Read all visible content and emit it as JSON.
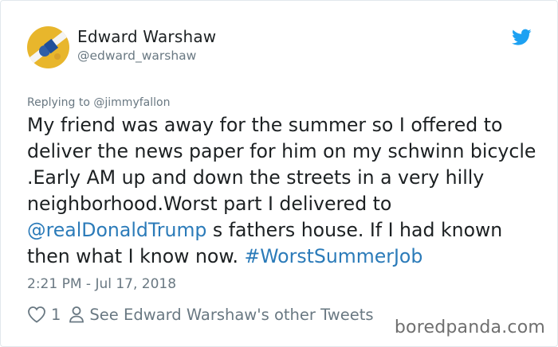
{
  "tweet": {
    "author_name": "Edward Warshaw",
    "author_handle": "@edward_warshaw",
    "replying_to_prefix": "Replying to ",
    "replying_to_handle": "@jimmyfallon",
    "text_1": "My friend was away for the summer so I offered to deliver the news paper for him on my schwinn bicycle .Early AM up and down the streets in a very hilly neighborhood.Worst part I delivered to ",
    "mention": "@realDonaldTrump",
    "text_2": " s fathers house. If I had known then what I know now. ",
    "hashtag": "#WorstSummerJob",
    "timestamp": "2:21 PM - Jul 17, 2018",
    "like_count": "1",
    "see_other_tweets": "See Edward Warshaw's other Tweets"
  },
  "watermark": "boredpanda.com",
  "icons": {
    "bird": "twitter-bird-icon",
    "heart": "heart-icon",
    "person": "person-icon"
  },
  "colors": {
    "link": "#2b7bb9",
    "twitter_blue": "#1da1f2",
    "muted": "#697882",
    "text": "#1c2022"
  }
}
